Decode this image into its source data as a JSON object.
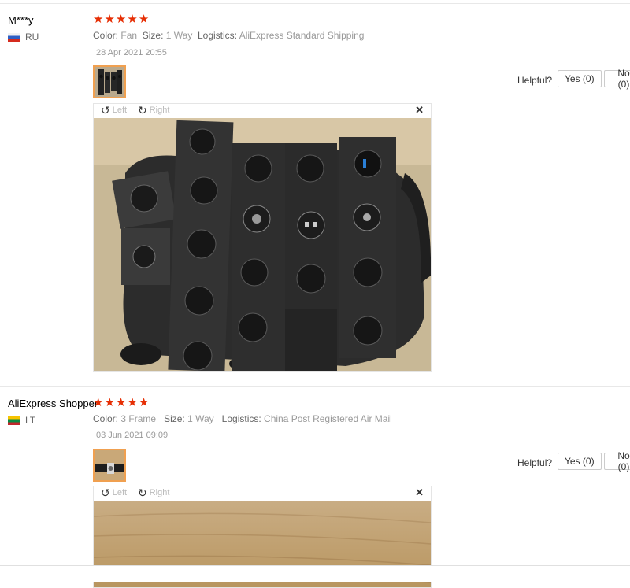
{
  "reviews": [
    {
      "user": "M***y",
      "country": "RU",
      "stars": 5,
      "color_label": "Color:",
      "color_value": "Fan",
      "size_label": "Size:",
      "size_value": "1 Way",
      "logistics_label": "Logistics:",
      "logistics_value": "AliExpress Standard Shipping",
      "date": "28 Apr 2021 20:55",
      "helpful_label": "Helpful?",
      "yes_label": "Yes (0)",
      "no_label": "No (0)",
      "rotate_left": "Left",
      "rotate_right": "Right",
      "close": "✕"
    },
    {
      "user": "AliExpress Shopper",
      "country": "LT",
      "stars": 5,
      "color_label": "Color:",
      "color_value": "3 Frame",
      "size_label": "Size:",
      "size_value": "1 Way",
      "logistics_label": "Logistics:",
      "logistics_value": "China Post Registered Air Mail",
      "date": "03 Jun 2021 09:09",
      "helpful_label": "Helpful?",
      "yes_label": "Yes (0)",
      "no_label": "No (0)",
      "rotate_left": "Left",
      "rotate_right": "Right",
      "close": "✕"
    }
  ],
  "icons": {
    "star": "star-icon",
    "rotate_left": "rotate-left-icon",
    "rotate_right": "rotate-right-icon",
    "close": "close-icon"
  },
  "colors": {
    "star": "#e62e04",
    "thumb_border": "#f0a050"
  }
}
